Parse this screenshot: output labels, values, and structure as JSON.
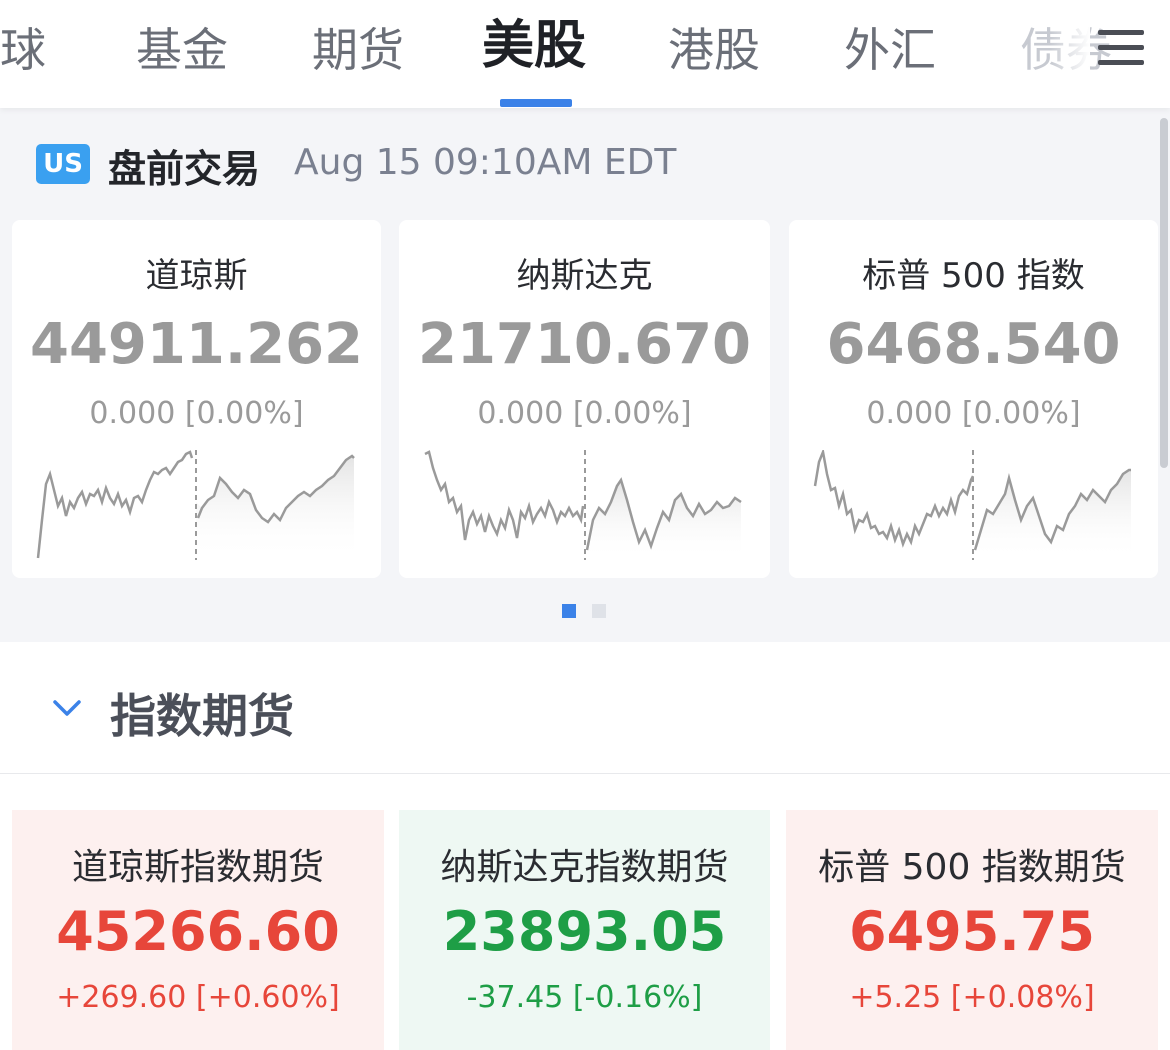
{
  "tabs": [
    {
      "label": "环球",
      "state": "partial"
    },
    {
      "label": "基金",
      "state": "normal"
    },
    {
      "label": "期货",
      "state": "normal"
    },
    {
      "label": "美股",
      "state": "active"
    },
    {
      "label": "港股",
      "state": "normal"
    },
    {
      "label": "外汇",
      "state": "normal"
    },
    {
      "label": "债券",
      "state": "faded"
    }
  ],
  "premarket": {
    "badge": "US",
    "title": "盘前交易",
    "timestamp": "Aug 15 09:10AM EDT",
    "cards": [
      {
        "name": "道琼斯",
        "price": "44911.262",
        "change": "0.000 [0.00%]"
      },
      {
        "name": "纳斯达克",
        "price": "21710.670",
        "change": "0.000 [0.00%]"
      },
      {
        "name": "标普 500 指数",
        "price": "6468.540",
        "change": "0.000 [0.00%]"
      }
    ],
    "page_indicator": {
      "current": 1,
      "total": 2
    }
  },
  "futures": {
    "section_title": "指数期货",
    "cards": [
      {
        "name": "道琼斯指数期货",
        "price": "45266.60",
        "change": "+269.60 [+0.60%]",
        "direction": "up"
      },
      {
        "name": "纳斯达克指数期货",
        "price": "23893.05",
        "change": "-37.45 [-0.16%]",
        "direction": "down"
      },
      {
        "name": "标普 500 指数期货",
        "price": "6495.75",
        "change": "+5.25 [+0.08%]",
        "direction": "up"
      }
    ]
  },
  "colors": {
    "accent": "#3b82e8",
    "up": "#e7463a",
    "down": "#1e9e46",
    "flat": "#9a9a9a",
    "badge": "#3aa0f0"
  },
  "icons": {
    "menu": "hamburger-menu-icon",
    "collapse": "chevron-down-icon"
  }
}
